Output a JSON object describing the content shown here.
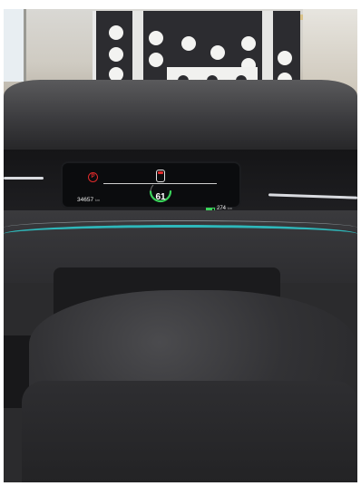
{
  "instrument_cluster": {
    "speed": "61",
    "odometer_value": "34657",
    "odometer_unit": "km",
    "range_value": "274",
    "range_unit": "km",
    "brake_symbol": "P"
  },
  "colors": {
    "trim_accent": "#2ec7c9",
    "gauge_green": "#3ad35a",
    "warning_red": "#e02b2b"
  },
  "icons": [
    "parking-brake-icon",
    "car-door-icon",
    "battery-icon"
  ]
}
